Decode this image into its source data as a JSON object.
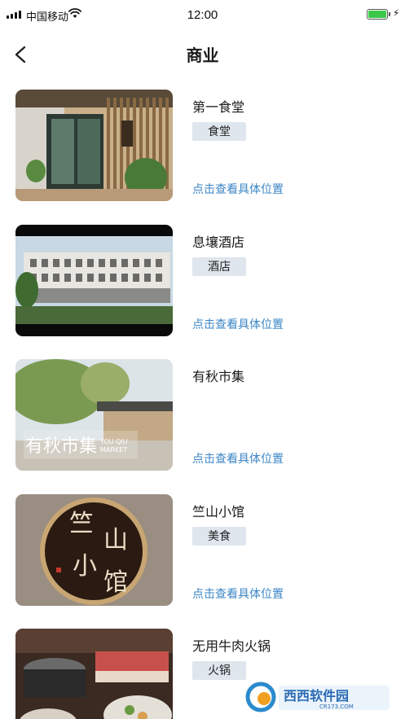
{
  "status_bar": {
    "carrier": "中国移动",
    "time": "12:00",
    "battery_level": 1.0,
    "battery_color": "#3cc74a"
  },
  "header": {
    "title": "商业"
  },
  "places": [
    {
      "name": "第一食堂",
      "tag": "食堂",
      "link": "点击查看具体位置"
    },
    {
      "name": "息壤酒店",
      "tag": "酒店",
      "link": "点击查看具体位置"
    },
    {
      "name": "有秋市集",
      "tag": "",
      "link": "点击查看具体位置"
    },
    {
      "name": "竺山小馆",
      "tag": "美食",
      "link": "点击查看具体位置"
    },
    {
      "name": "无用牛肉火锅",
      "tag": "火锅",
      "link": ""
    }
  ],
  "watermark": {
    "brand": "西西软件园",
    "domain": "CR173.COM"
  },
  "colors": {
    "link": "#3b86c6",
    "tag_bg": "#dfe6ee"
  }
}
